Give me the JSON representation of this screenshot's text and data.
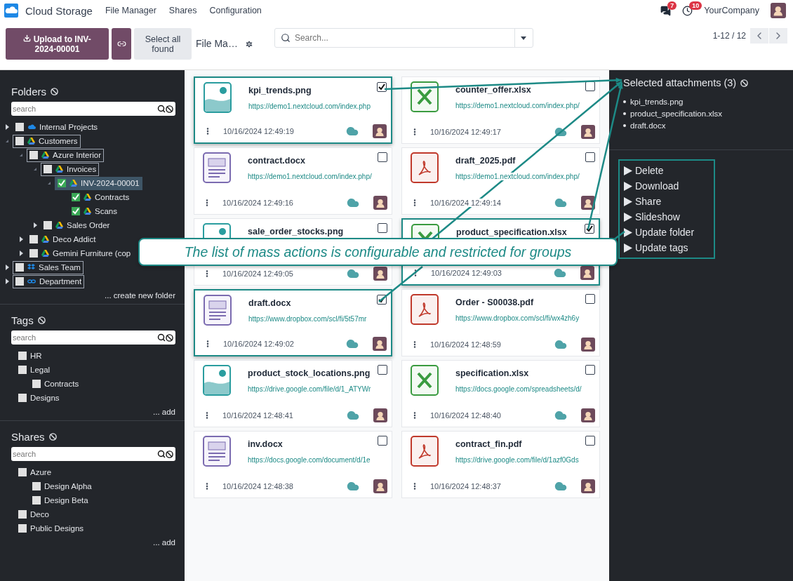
{
  "app": {
    "title": "Cloud Storage"
  },
  "menu": [
    {
      "label": "File Manager"
    },
    {
      "label": "Shares"
    },
    {
      "label": "Configuration"
    }
  ],
  "systray": {
    "messages_count": "7",
    "activities_count": "10",
    "company": "YourCompany"
  },
  "control_panel": {
    "upload_button": "Upload to INV-2024-00001",
    "select_all_button": "Select all found",
    "breadcrumb": "File Ma…",
    "search_placeholder": "Search...",
    "pager": "1-12 / 12"
  },
  "sidebar": [
    {
      "title": "Folders",
      "search_placeholder": "search",
      "footer_link": "... create new folder",
      "items": [
        {
          "label": "Internal Projects",
          "kind": "cloud",
          "expanded": false,
          "checked": false,
          "highlighted": false,
          "selected": false
        },
        {
          "label": "Customers",
          "kind": "drive",
          "expanded": true,
          "checked": false,
          "highlighted": true,
          "selected": false,
          "children": [
            {
              "label": "Azure Interior",
              "kind": "drive",
              "expanded": true,
              "checked": false,
              "highlighted": true,
              "selected": false,
              "children": [
                {
                  "label": "Invoices",
                  "kind": "drive",
                  "expanded": true,
                  "checked": false,
                  "highlighted": true,
                  "selected": false,
                  "children": [
                    {
                      "label": "INV-2024-00001",
                      "kind": "drive",
                      "expanded": true,
                      "checked": true,
                      "highlighted": false,
                      "selected": true,
                      "children": [
                        {
                          "label": "Contracts",
                          "kind": "drive",
                          "checked": true,
                          "highlighted": false,
                          "selected": false
                        },
                        {
                          "label": "Scans",
                          "kind": "drive",
                          "checked": true,
                          "highlighted": false,
                          "selected": false
                        }
                      ]
                    }
                  ]
                },
                {
                  "label": "Sales Order",
                  "kind": "drive",
                  "expanded": false,
                  "checked": false,
                  "highlighted": false,
                  "selected": false
                }
              ]
            },
            {
              "label": "Deco Addict",
              "kind": "drive",
              "expanded": false,
              "checked": false,
              "highlighted": false,
              "selected": false
            },
            {
              "label": "Gemini Furniture (cop",
              "kind": "drive",
              "expanded": false,
              "checked": false,
              "highlighted": false,
              "selected": false
            }
          ]
        },
        {
          "label": "Sales Team",
          "kind": "box",
          "expanded": false,
          "checked": false,
          "highlighted": true,
          "selected": false
        },
        {
          "label": "Department",
          "kind": "link",
          "expanded": false,
          "checked": false,
          "highlighted": true,
          "selected": false
        }
      ]
    },
    {
      "title": "Tags",
      "search_placeholder": "search",
      "footer_link": "... add",
      "items": [
        {
          "label": "HR",
          "checked": false
        },
        {
          "label": "Legal",
          "checked": false,
          "children": [
            {
              "label": "Contracts",
              "checked": false
            }
          ]
        },
        {
          "label": "Designs",
          "checked": false
        }
      ]
    },
    {
      "title": "Shares",
      "search_placeholder": "search",
      "footer_link": "... add",
      "items": [
        {
          "label": "Azure",
          "checked": false,
          "children": [
            {
              "label": "Design Alpha",
              "checked": false
            },
            {
              "label": "Design Beta",
              "checked": false
            }
          ]
        },
        {
          "label": "Deco",
          "checked": false
        },
        {
          "label": "Public Designs",
          "checked": false
        }
      ]
    }
  ],
  "cards": [
    {
      "name": "kpi_trends.png",
      "kind": "image",
      "url": "https://demo1.nextcloud.com/index.php",
      "date": "10/16/2024 12:49:19",
      "selected": true
    },
    {
      "name": "counter_offer.xlsx",
      "kind": "sheet",
      "url": "https://demo1.nextcloud.com/index.php/",
      "date": "10/16/2024 12:49:17",
      "selected": false
    },
    {
      "name": "contract.docx",
      "kind": "doc",
      "url": "https://demo1.nextcloud.com/index.php/",
      "date": "10/16/2024 12:49:16",
      "selected": false
    },
    {
      "name": "draft_2025.pdf",
      "kind": "pdf",
      "url": "https://demo1.nextcloud.com/index.php/",
      "date": "10/16/2024 12:49:14",
      "selected": false
    },
    {
      "name": "sale_order_stocks.png",
      "kind": "image",
      "date": "10/16/2024 12:49:05",
      "selected": false
    },
    {
      "name": "product_specification.xlsx",
      "kind": "sheet",
      "date": "10/16/2024 12:49:03",
      "selected": true
    },
    {
      "name": "draft.docx",
      "kind": "doc",
      "url": "https://www.dropbox.com/scl/fi/5t57mr",
      "date": "10/16/2024 12:49:02",
      "selected": true
    },
    {
      "name": "Order - S00038.pdf",
      "kind": "pdf",
      "url": "https://www.dropbox.com/scl/fi/wx4zh6y",
      "date": "10/16/2024 12:48:59",
      "selected": false
    },
    {
      "name": "product_stock_locations.png",
      "kind": "image",
      "url": "https://drive.google.com/file/d/1_ATYWr",
      "date": "10/16/2024 12:48:41",
      "selected": false
    },
    {
      "name": "specification.xlsx",
      "kind": "sheet",
      "url": "https://docs.google.com/spreadsheets/d/",
      "date": "10/16/2024 12:48:40",
      "selected": false
    },
    {
      "name": "inv.docx",
      "kind": "doc",
      "url": "https://docs.google.com/document/d/1e",
      "date": "10/16/2024 12:48:38",
      "selected": false
    },
    {
      "name": "contract_fin.pdf",
      "kind": "pdf",
      "url": "https://drive.google.com/file/d/1azf0Gds",
      "date": "10/16/2024 12:48:37",
      "selected": false
    }
  ],
  "selection_panel": {
    "title": "Selected attachments (3)",
    "items": [
      "kpi_trends.png",
      "product_specification.xlsx",
      "draft.docx"
    ],
    "actions": [
      "Delete",
      "Download",
      "Share",
      "Slideshow",
      "Update folder",
      "Update tags"
    ]
  },
  "callout": {
    "text": "The list of mass actions is configurable and restricted for groups"
  }
}
